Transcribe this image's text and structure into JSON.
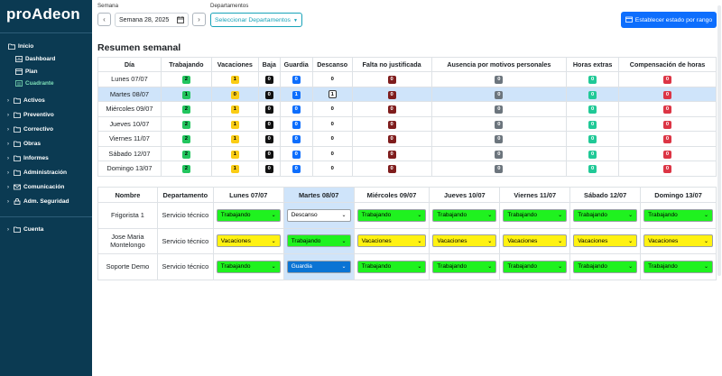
{
  "sidebar": {
    "brand": "proAdeon",
    "items": [
      {
        "label": "Inicio",
        "icon": "folder-open-icon"
      },
      {
        "label": "Dashboard",
        "icon": "dashboard-icon"
      },
      {
        "label": "Plan",
        "icon": "plan-icon"
      },
      {
        "label": "Cuadrante",
        "icon": "calendar-icon"
      },
      {
        "label": "Activos",
        "icon": "box-icon"
      },
      {
        "label": "Preventivo",
        "icon": "shield-icon"
      },
      {
        "label": "Correctivo",
        "icon": "wrench-icon"
      },
      {
        "label": "Obras",
        "icon": "building-icon"
      },
      {
        "label": "Informes",
        "icon": "report-icon"
      },
      {
        "label": "Administración",
        "icon": "admin-icon"
      },
      {
        "label": "Comunicación",
        "icon": "mail-icon"
      },
      {
        "label": "Adm. Seguridad",
        "icon": "lock-icon"
      },
      {
        "label": "Cuenta",
        "icon": "user-icon"
      }
    ]
  },
  "toolbar": {
    "week_label": "Semana",
    "week_value": "Semana 28, 2025",
    "prev": "‹",
    "next": "›",
    "dept_label": "Departamentos",
    "dept_value": "Seleccionar Departamentos",
    "range_button": "Establecer estado por rango"
  },
  "summary": {
    "title": "Resumen semanal",
    "headers": [
      "Día",
      "Trabajando",
      "Vacaciones",
      "Baja",
      "Guardia",
      "Descanso",
      "Falta no justificada",
      "Ausencia por motivos personales",
      "Horas extras",
      "Compensación de horas"
    ],
    "rows": [
      {
        "day": "Lunes 07/07",
        "values": [
          "2",
          "1",
          "0",
          "0",
          "0",
          "0",
          "0",
          "0",
          "0"
        ]
      },
      {
        "day": "Martes 08/07",
        "values": [
          "1",
          "0",
          "0",
          "1",
          "1",
          "0",
          "0",
          "0",
          "0"
        ]
      },
      {
        "day": "Miércoles 09/07",
        "values": [
          "2",
          "1",
          "0",
          "0",
          "0",
          "0",
          "0",
          "0",
          "0"
        ]
      },
      {
        "day": "Jueves 10/07",
        "values": [
          "2",
          "1",
          "0",
          "0",
          "0",
          "0",
          "0",
          "0",
          "0"
        ]
      },
      {
        "day": "Viernes 11/07",
        "values": [
          "2",
          "1",
          "0",
          "0",
          "0",
          "0",
          "0",
          "0",
          "0"
        ]
      },
      {
        "day": "Sábado 12/07",
        "values": [
          "2",
          "1",
          "0",
          "0",
          "0",
          "0",
          "0",
          "0",
          "0"
        ]
      },
      {
        "day": "Domingo 13/07",
        "values": [
          "2",
          "1",
          "0",
          "0",
          "0",
          "0",
          "0",
          "0",
          "0"
        ]
      }
    ],
    "selected_row": 1,
    "badge_colors": [
      "#22c55e",
      "#facc15",
      "#111111",
      "#0d6efd",
      "#ffffff",
      "#7f1d1d",
      "#6c757d",
      "#20c997",
      "#dc3545"
    ]
  },
  "schedule": {
    "headers": [
      "Nombre",
      "Departamento",
      "Lunes 07/07",
      "Martes 08/07",
      "Miércoles 09/07",
      "Jueves 10/07",
      "Viernes 11/07",
      "Sábado 12/07",
      "Domingo 13/07"
    ],
    "rows": [
      {
        "name": "Frigorista 1",
        "dept": "Servicio técnico",
        "days": [
          "Trabajando",
          "Descanso",
          "Trabajando",
          "Trabajando",
          "Trabajando",
          "Trabajando",
          "Trabajando"
        ]
      },
      {
        "name": "Jose Maria Montelongo",
        "dept": "Servicio técnico",
        "days": [
          "Vacaciones",
          "Trabajando",
          "Vacaciones",
          "Vacaciones",
          "Vacaciones",
          "Vacaciones",
          "Vacaciones"
        ]
      },
      {
        "name": "Soporte Demo",
        "dept": "Servicio técnico",
        "days": [
          "Trabajando",
          "Guardia",
          "Trabajando",
          "Trabajando",
          "Trabajando",
          "Trabajando",
          "Trabajando"
        ]
      }
    ],
    "highlight_col": 1,
    "status_colors": {
      "Trabajando": "#1ff21f",
      "Vacaciones": "#fff212",
      "Descanso": "#ffffff",
      "Guardia": "#0b74d4"
    }
  }
}
